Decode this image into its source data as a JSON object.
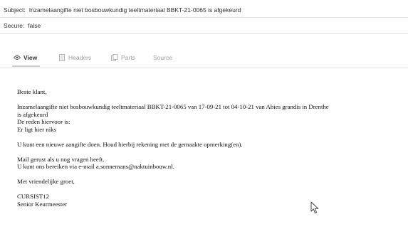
{
  "header": {
    "subject_label": "Subject:",
    "subject_value": "Inzamelaangifte niet bosbouwkundig teeltmateriaal BBKT-21-0065 is afgekeurd",
    "secure_label": "Secure:",
    "secure_value": "false"
  },
  "tabs": [
    {
      "label": "View",
      "icon": "eye-icon",
      "active": true
    },
    {
      "label": "Headers",
      "icon": "document-icon",
      "active": false
    },
    {
      "label": "Parts",
      "icon": "copy-icon",
      "active": false
    },
    {
      "label": "Source",
      "icon": "",
      "active": false
    }
  ],
  "body": {
    "greeting": "Beste klant,",
    "line1": "Inzamelaangifte niet bosbouwkundig teeltmateriaal BBKT-21-0065 van 17-09-21 tot 04-10-21 van Abies grandis in Drenthe",
    "line2": "is afgekeurd",
    "line3": "De reden hiervoor is:",
    "line4": "Er ligt hier niks",
    "line5": "U kunt een nieuwe aangifte doen. Houd hierbij rekening met de gemaakte opmerking(en).",
    "line6": "Mail gerust als u nog vragen heeft.",
    "line7": "U kunt ons bereiken via e-mail a.sonnemans@naktuinbouw.nl.",
    "closing": "Met vriendelijke groet,",
    "signature_name": "CURSIST12",
    "signature_title": "Senior Keurmeester"
  }
}
